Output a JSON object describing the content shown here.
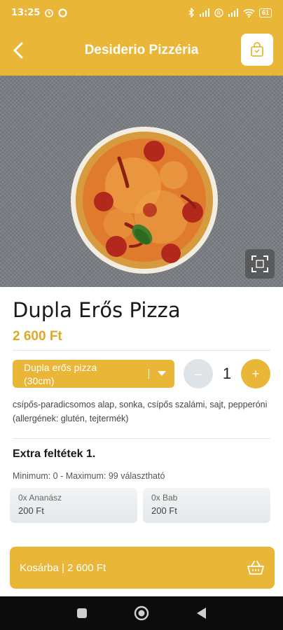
{
  "status": {
    "time": "13:25",
    "battery": "61"
  },
  "header": {
    "title": "Desiderio Pizzéria"
  },
  "product": {
    "name": "Dupla Erős Pizza",
    "price": "2 600 Ft",
    "size_line1": "Dupla erős pizza",
    "size_line2": "(30cm)",
    "quantity": "1",
    "minus": "–",
    "plus": "+",
    "description": "csípős-paradicsomos alap, sonka, csípős szalámi, sajt, pepperóni (allergének: glutén, tejtermék)"
  },
  "extras": {
    "title": "Extra feltétek 1.",
    "limit": "Minimum: 0 - Maximum: 99 választható",
    "items": [
      {
        "name": "0x Ananász",
        "price": "200 Ft"
      },
      {
        "name": "0x Bab",
        "price": "200 Ft"
      }
    ]
  },
  "cart_button": {
    "label": "Kosárba | 2 600 Ft"
  },
  "colors": {
    "accent": "#e9b637",
    "price": "#e0a827"
  },
  "icons": [
    "alarm-icon",
    "sync-icon",
    "bluetooth-icon",
    "signal-icon",
    "wifi-icon",
    "back-arrow-icon",
    "shopping-bag-icon",
    "fullscreen-icon",
    "basket-icon",
    "nav-square-icon",
    "nav-circle-icon",
    "nav-back-icon"
  ]
}
